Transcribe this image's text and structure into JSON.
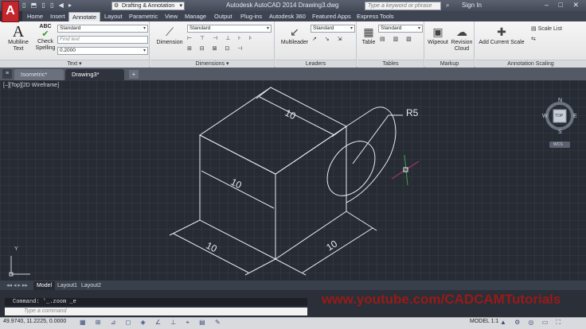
{
  "app": {
    "title": "Autodesk AutoCAD 2014    Drawing3.dwg",
    "app_letter": "A",
    "workspace": "Drafting & Annotation",
    "search_placeholder": "Type a keyword or phrase",
    "signin": "Sign In",
    "window_controls": "– □ ✕",
    "qat_glyphs": "▯ ⬒ ▯ ▯ ◀ ▸"
  },
  "ribbon_tabs": [
    "Home",
    "Insert",
    "Annotate",
    "Layout",
    "Parametric",
    "View",
    "Manage",
    "Output",
    "Plug-ins",
    "Autodesk 360",
    "Featured Apps",
    "Express Tools"
  ],
  "active_tab": "Annotate",
  "ribbon": {
    "text_panel": {
      "title": "Text ▾",
      "multiline": "Multiline\nText",
      "check": "Check\nSpelling",
      "abc": "ABC",
      "style": "Standard",
      "find_placeholder": "Find text",
      "height": "0.2000"
    },
    "dimensions_panel": {
      "title": "Dimensions ▾",
      "dimension": "Dimension",
      "style": "Standard"
    },
    "leaders_panel": {
      "title": "Leaders",
      "multileader": "Multileader",
      "style": "Standard"
    },
    "tables_panel": {
      "title": "Tables",
      "table": "Table",
      "style": "Standard"
    },
    "markup_panel": {
      "title": "Markup",
      "wipeout": "Wipeout",
      "revision": "Revision\nCloud"
    },
    "scaling_panel": {
      "title": "Annotation Scaling",
      "add_scale": "Add Current Scale",
      "scale_list": "Scale List"
    }
  },
  "doc_tabs": [
    "Isometric*",
    "Drawing3*"
  ],
  "active_doc": "Drawing3*",
  "viewport_controls": "[–][Top][2D Wireframe]",
  "drawing": {
    "dims": [
      "10",
      "10",
      "10",
      "10"
    ],
    "radius_label": "R5"
  },
  "viewcube": {
    "top": "TOP",
    "n": "N",
    "s": "S",
    "e": "E",
    "w": "W",
    "wcs": "WCS"
  },
  "layout_tabs": [
    "Model",
    "Layout1",
    "Layout2"
  ],
  "command": {
    "history": "Command:  '_.zoom _e",
    "placeholder": "Type a command"
  },
  "watermark": "www.youtube.com/CADCAMTutorials",
  "status": {
    "coords": "49.9740, 11.2225, 0.0000",
    "model": "MODEL",
    "scale": "1:1",
    "icons": "▦ ⊞ ⊿ ◻ ◈ ∠ ⊥ ⌖ ▤ ✎",
    "right_icons": "▲ ⚙ ◎ ▭ ⛶"
  },
  "colors": {
    "app_red": "#c4262e",
    "viewport_bg": "#262b34",
    "drawing_line": "#e8ecf2",
    "watermark": "#9a1a16"
  }
}
